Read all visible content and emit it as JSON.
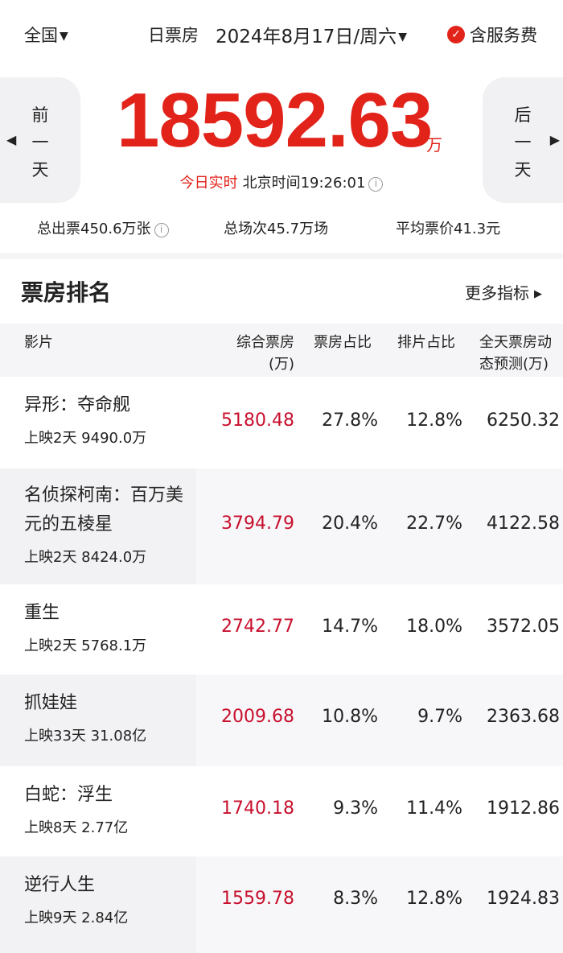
{
  "topbar": {
    "region": "全国",
    "date_label": "日票房",
    "date_value": "2024年8月17日/周六",
    "fee_label": "含服务费",
    "check_icon": "check-circle-icon",
    "accent": "#e2231a"
  },
  "hero": {
    "prev_chars": [
      "前",
      "一",
      "天"
    ],
    "next_chars": [
      "后",
      "一",
      "天"
    ],
    "total": "18592.63",
    "unit": "万",
    "realtime_label": "今日实时",
    "beijing_time_label": "北京时间",
    "time": "19:26:01"
  },
  "stats": {
    "tickets": "总出票450.6万张",
    "shows": "总场次45.7万场",
    "avg_price": "平均票价41.3元"
  },
  "ranking": {
    "title": "票房排名",
    "more": "更多指标",
    "headers": {
      "film": "影片",
      "gross_line1": "综合票房",
      "gross_line2": "(万)",
      "share": "票房占比",
      "schedule": "排片占比",
      "forecast_line1": "全天票房动",
      "forecast_line2": "态预测(万)"
    },
    "rows": [
      {
        "name": "异形：夺命舰",
        "meta": "上映2天  9490.0万",
        "gross": "5180.48",
        "share": "27.8%",
        "schedule": "12.8%",
        "forecast": "6250.32"
      },
      {
        "name": "名侦探柯南：百万美元的五棱星",
        "meta": "上映2天  8424.0万",
        "gross": "3794.79",
        "share": "20.4%",
        "schedule": "22.7%",
        "forecast": "4122.58"
      },
      {
        "name": "重生",
        "meta": "上映2天  5768.1万",
        "gross": "2742.77",
        "share": "14.7%",
        "schedule": "18.0%",
        "forecast": "3572.05"
      },
      {
        "name": "抓娃娃",
        "meta": "上映33天  31.08亿",
        "gross": "2009.68",
        "share": "10.8%",
        "schedule": "9.7%",
        "forecast": "2363.68"
      },
      {
        "name": "白蛇：浮生",
        "meta": "上映8天  2.77亿",
        "gross": "1740.18",
        "share": "9.3%",
        "schedule": "11.4%",
        "forecast": "1912.86"
      },
      {
        "name": "逆行人生",
        "meta": "上映9天  2.84亿",
        "gross": "1559.78",
        "share": "8.3%",
        "schedule": "12.8%",
        "forecast": "1924.83"
      }
    ]
  }
}
